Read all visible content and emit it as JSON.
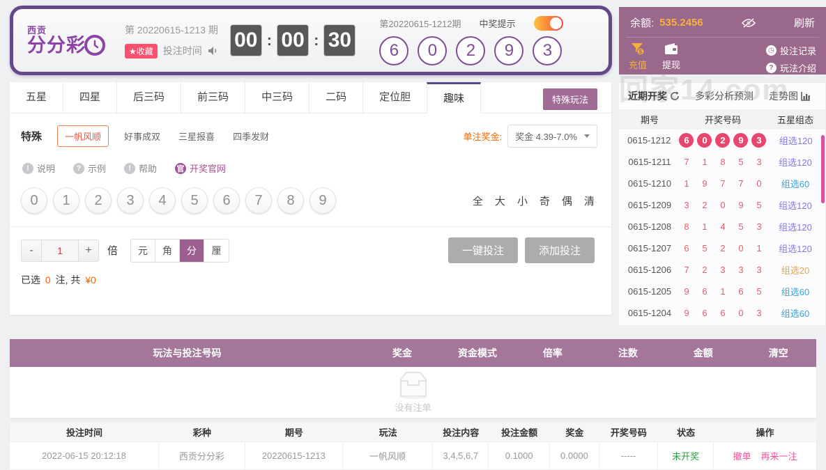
{
  "header": {
    "logo": {
      "top": "西贡",
      "main": "分分彩"
    },
    "period_label": "第 20220615-1213 期",
    "favorite_badge": "★收藏",
    "bet_time_label": "投注时间",
    "countdown": {
      "h": "00",
      "m": "00",
      "s": "30"
    },
    "last_draw": {
      "period": "第20220615-1212期",
      "win_tip_label": "中奖提示",
      "numbers": [
        "6",
        "0",
        "2",
        "9",
        "3"
      ]
    }
  },
  "account": {
    "balance_label": "余额:",
    "balance": "535.2456",
    "refresh_label": "刷新",
    "recharge_label": "充值",
    "withdraw_label": "提现",
    "bet_record_label": "投注记录",
    "play_intro_label": "玩法介绍"
  },
  "main": {
    "tabs": [
      "五星",
      "四星",
      "后三码",
      "前三码",
      "中三码",
      "二码",
      "定位胆",
      "趣味"
    ],
    "active_tab": "趣味",
    "special_play_button": "特殊玩法",
    "sub": {
      "group_label": "特殊",
      "items": [
        "一帆风顺",
        "好事成双",
        "三星报喜",
        "四季发财"
      ],
      "active": "一帆风顺"
    },
    "prize_label": "单注奖金:",
    "prize_value": "奖金 4.39-7.0%",
    "help_links": [
      {
        "icon": "!",
        "label": "说明",
        "style": "gray"
      },
      {
        "icon": "?",
        "label": "示例",
        "style": "gray"
      },
      {
        "icon": "!",
        "label": "帮助",
        "style": "gray"
      },
      {
        "icon": "官",
        "label": "开奖官网",
        "style": "purple"
      }
    ],
    "balls": [
      "0",
      "1",
      "2",
      "3",
      "4",
      "5",
      "6",
      "7",
      "8",
      "9"
    ],
    "quick_selects": [
      "全",
      "大",
      "小",
      "奇",
      "偶",
      "清"
    ],
    "multiplier": {
      "minus": "-",
      "value": "1",
      "plus": "+",
      "label": "倍"
    },
    "units": [
      "元",
      "角",
      "分",
      "厘"
    ],
    "active_unit": "分",
    "one_key_bet_label": "一键投注",
    "add_bet_label": "添加投注",
    "summary": {
      "prefix": "已选",
      "count": "0",
      "middle": "注, 共",
      "amount": "¥0"
    }
  },
  "sidebar": {
    "tab_recent": "近期开奖",
    "tab_analysis": "多彩分析预测",
    "tab_trend": "走势图",
    "columns": [
      "期号",
      "开奖号码",
      "五星组态"
    ],
    "rows": [
      {
        "period": "0615-1212",
        "numbers": [
          "6",
          "0",
          "2",
          "9",
          "3"
        ],
        "pattern": "组选120",
        "pattern_color": "purple",
        "highlight": true
      },
      {
        "period": "0615-1211",
        "numbers": [
          "7",
          "1",
          "8",
          "5",
          "3"
        ],
        "pattern": "组选120",
        "pattern_color": "purple"
      },
      {
        "period": "0615-1210",
        "numbers": [
          "1",
          "9",
          "7",
          "7",
          "0"
        ],
        "pattern": "组选60",
        "pattern_color": "blue"
      },
      {
        "period": "0615-1209",
        "numbers": [
          "3",
          "2",
          "0",
          "9",
          "5"
        ],
        "pattern": "组选120",
        "pattern_color": "purple"
      },
      {
        "period": "0615-1208",
        "numbers": [
          "8",
          "1",
          "4",
          "5",
          "3"
        ],
        "pattern": "组选120",
        "pattern_color": "purple"
      },
      {
        "period": "0615-1207",
        "numbers": [
          "6",
          "5",
          "2",
          "0",
          "1"
        ],
        "pattern": "组选120",
        "pattern_color": "purple"
      },
      {
        "period": "0615-1206",
        "numbers": [
          "7",
          "2",
          "3",
          "3",
          "3"
        ],
        "pattern": "组选20",
        "pattern_color": "orange"
      },
      {
        "period": "0615-1205",
        "numbers": [
          "9",
          "6",
          "1",
          "6",
          "5"
        ],
        "pattern": "组选60",
        "pattern_color": "blue"
      },
      {
        "period": "0615-1204",
        "numbers": [
          "9",
          "6",
          "6",
          "0",
          "3"
        ],
        "pattern": "组选60",
        "pattern_color": "blue"
      }
    ]
  },
  "cart": {
    "columns": [
      "玩法与投注号码",
      "奖金",
      "资金模式",
      "倍率",
      "注数",
      "金额",
      "清空"
    ],
    "empty_text": "没有注单"
  },
  "orders": {
    "columns": [
      "投注时间",
      "彩种",
      "期号",
      "玩法",
      "投注内容",
      "投注金额",
      "奖金",
      "开奖号码",
      "状态",
      "操作"
    ],
    "rows": [
      {
        "time": "2022-06-15 20:12:18",
        "lottery": "西贡分分彩",
        "period": "20220615-1213",
        "play": "一帆风顺",
        "content": "3,4,5,6,7",
        "amount": "0.1000",
        "prize": "0.0000",
        "draw": "-----",
        "status": "未开奖",
        "actions": [
          "撤单",
          "再来一注"
        ]
      }
    ]
  },
  "watermark": "回家14.com",
  "colors": {
    "accent_purple": "#63488a",
    "panel_mauve": "#9a688a",
    "accent_orange": "#ff6600",
    "highlight_pink": "#e8456f",
    "balance_gold": "#f5b03e"
  }
}
